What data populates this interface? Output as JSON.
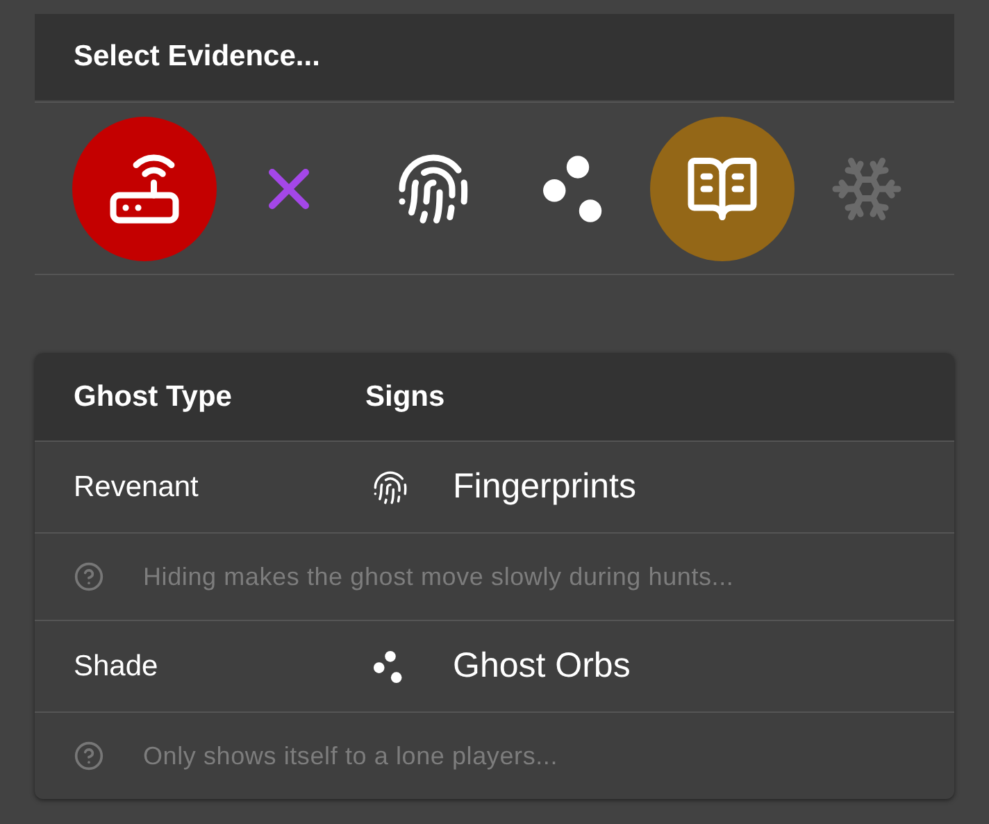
{
  "header": {
    "title": "Select Evidence..."
  },
  "evidence": [
    {
      "kind": "router",
      "confirmed": true,
      "highlighted": false,
      "disabled": false
    },
    {
      "kind": "cross",
      "confirmed": false,
      "highlighted": false,
      "disabled": false
    },
    {
      "kind": "fingerprint",
      "confirmed": false,
      "highlighted": false,
      "disabled": false
    },
    {
      "kind": "orbs",
      "confirmed": false,
      "highlighted": false,
      "disabled": false
    },
    {
      "kind": "book",
      "confirmed": false,
      "highlighted": true,
      "disabled": false
    },
    {
      "kind": "snowflake",
      "confirmed": false,
      "highlighted": false,
      "disabled": true
    }
  ],
  "table": {
    "columns": [
      "Ghost Type",
      "Signs"
    ],
    "rows": [
      {
        "ghost": "Revenant",
        "kind": "fingerprint",
        "sign": "Fingerprints",
        "hint": "Hiding makes the ghost move slowly during hunts..."
      },
      {
        "ghost": "Shade",
        "kind": "orbs",
        "sign": "Ghost Orbs",
        "hint": "Only shows itself to a lone players..."
      }
    ]
  }
}
